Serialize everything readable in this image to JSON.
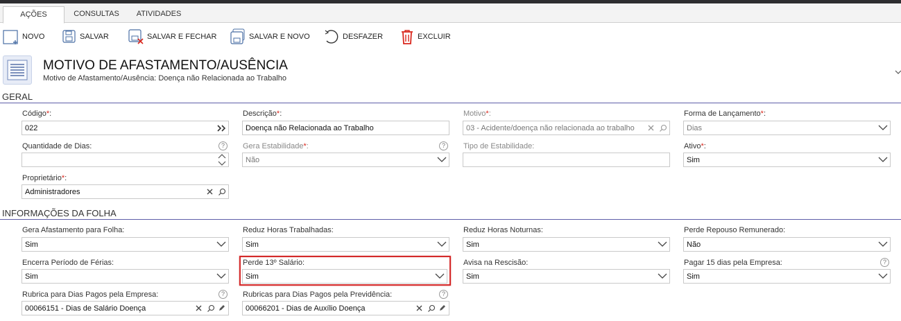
{
  "tabs": [
    {
      "label": "AÇÕES",
      "active": true
    },
    {
      "label": "CONSULTAS",
      "active": false
    },
    {
      "label": "ATIVIDADES",
      "active": false
    }
  ],
  "toolbar": {
    "novo": "NOVO",
    "salvar": "SALVAR",
    "salvar_fechar": "SALVAR E FECHAR",
    "salvar_novo": "SALVAR E NOVO",
    "desfazer": "DESFAZER",
    "excluir": "EXCLUIR"
  },
  "header": {
    "title": "MOTIVO DE AFASTAMENTO/AUSÊNCIA",
    "subtitle": "Motivo de Afastamento/Ausência: Doença não Relacionada ao Trabalho"
  },
  "sections": {
    "geral": "GERAL",
    "folha": "INFORMAÇÕES DA FOLHA"
  },
  "required_mark": "*",
  "help_mark": "?",
  "fields": {
    "codigo": {
      "label": "Código",
      "value": "022"
    },
    "descricao": {
      "label": "Descrição",
      "value": "Doença não Relacionada ao Trabalho"
    },
    "motivo": {
      "label": "Motivo",
      "value": "03 - Acidente/doença não relacionada ao trabalho"
    },
    "forma_lancamento": {
      "label": "Forma de Lançamento",
      "value": "Dias"
    },
    "quantidade_dias": {
      "label": "Quantidade de Dias:",
      "value": ""
    },
    "gera_estabilidade": {
      "label": "Gera Estabilidade",
      "value": "Não"
    },
    "tipo_estabilidade": {
      "label": "Tipo de Estabilidade:",
      "value": ""
    },
    "ativo": {
      "label": "Ativo",
      "value": "Sim"
    },
    "proprietario": {
      "label": "Proprietário",
      "value": "Administradores"
    },
    "gera_afastamento": {
      "label": "Gera Afastamento para Folha:",
      "value": "Sim"
    },
    "reduz_horas_trab": {
      "label": "Reduz Horas Trabalhadas:",
      "value": "Sim"
    },
    "reduz_horas_not": {
      "label": "Reduz Horas Noturnas:",
      "value": "Sim"
    },
    "perde_repouso": {
      "label": "Perde Repouso Remunerado:",
      "value": "Não"
    },
    "encerra_periodo": {
      "label": "Encerra Período de Férias:",
      "value": "Sim"
    },
    "perde_13": {
      "label": "Perde 13º Salário:",
      "value": "Sim"
    },
    "avisa_rescisao": {
      "label": "Avisa na Rescisão:",
      "value": "Sim"
    },
    "pagar_15": {
      "label": "Pagar 15 dias pela Empresa:",
      "value": "Sim"
    },
    "rubrica_empresa": {
      "label": "Rubrica para Dias Pagos pela Empresa:",
      "value": "00066151 - Dias de Salário Doença"
    },
    "rubricas_previdencia": {
      "label": "Rubricas para Dias Pagos pela Previdência:",
      "value": "00066201 - Dias de Auxílio Doença"
    }
  },
  "colors": {
    "section_line": "#5e5ea8",
    "required": "#d9261c",
    "highlight": "#d42b2b",
    "toolbar_icon": "#4a6fa5"
  }
}
